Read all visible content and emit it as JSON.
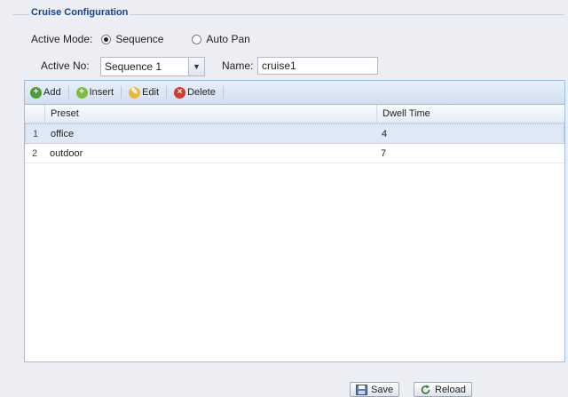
{
  "section": {
    "title": "Cruise Configuration"
  },
  "mode": {
    "label": "Active Mode:",
    "options": [
      {
        "label": "Sequence",
        "selected": true
      },
      {
        "label": "Auto Pan",
        "selected": false
      }
    ]
  },
  "active_no": {
    "label": "Active No:",
    "value": "Sequence 1"
  },
  "name": {
    "label": "Name:",
    "value": "cruise1"
  },
  "toolbar": {
    "add": "Add",
    "insert": "Insert",
    "edit": "Edit",
    "delete": "Delete"
  },
  "grid": {
    "columns": [
      "Preset",
      "Dwell Time"
    ],
    "rows": [
      {
        "num": "1",
        "preset": "office",
        "dwell": "4",
        "selected": true
      },
      {
        "num": "2",
        "preset": "outdoor",
        "dwell": "7",
        "selected": false
      }
    ]
  },
  "footer": {
    "save": "Save",
    "reload": "Reload"
  },
  "colors": {
    "title": "#15428b",
    "border": "#99bbe8",
    "selected_row": "#dfe8f6"
  }
}
